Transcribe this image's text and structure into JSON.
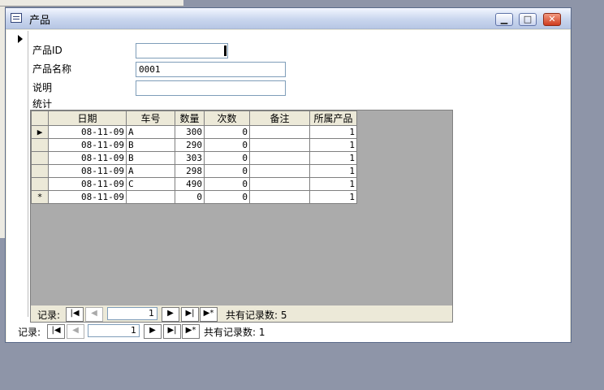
{
  "window": {
    "title": "产品"
  },
  "form": {
    "fields": [
      {
        "label": "产品ID",
        "value": ""
      },
      {
        "label": "产品名称",
        "value": "0001"
      },
      {
        "label": "说明",
        "value": ""
      }
    ],
    "subform_label": "统计"
  },
  "subform": {
    "columns": [
      "日期",
      "车号",
      "数量",
      "次数",
      "备注",
      "所属产品"
    ],
    "rows": [
      {
        "date": "08-11-09",
        "car": "A",
        "qty": "300",
        "count": "0",
        "note": "",
        "product": "1"
      },
      {
        "date": "08-11-09",
        "car": "B",
        "qty": "290",
        "count": "0",
        "note": "",
        "product": "1"
      },
      {
        "date": "08-11-09",
        "car": "B",
        "qty": "303",
        "count": "0",
        "note": "",
        "product": "1"
      },
      {
        "date": "08-11-09",
        "car": "A",
        "qty": "298",
        "count": "0",
        "note": "",
        "product": "1"
      },
      {
        "date": "08-11-09",
        "car": "C",
        "qty": "490",
        "count": "0",
        "note": "",
        "product": "1"
      }
    ],
    "new_row": {
      "marker": "*",
      "date": "08-11-09",
      "car": "",
      "qty": "0",
      "count": "0",
      "note": "",
      "product": "1"
    },
    "nav": {
      "label": "记录:",
      "current": "1",
      "total_text": "共有记录数: 5"
    }
  },
  "main_nav": {
    "label": "记录:",
    "current": "1",
    "total_text": "共有记录数: 1"
  }
}
